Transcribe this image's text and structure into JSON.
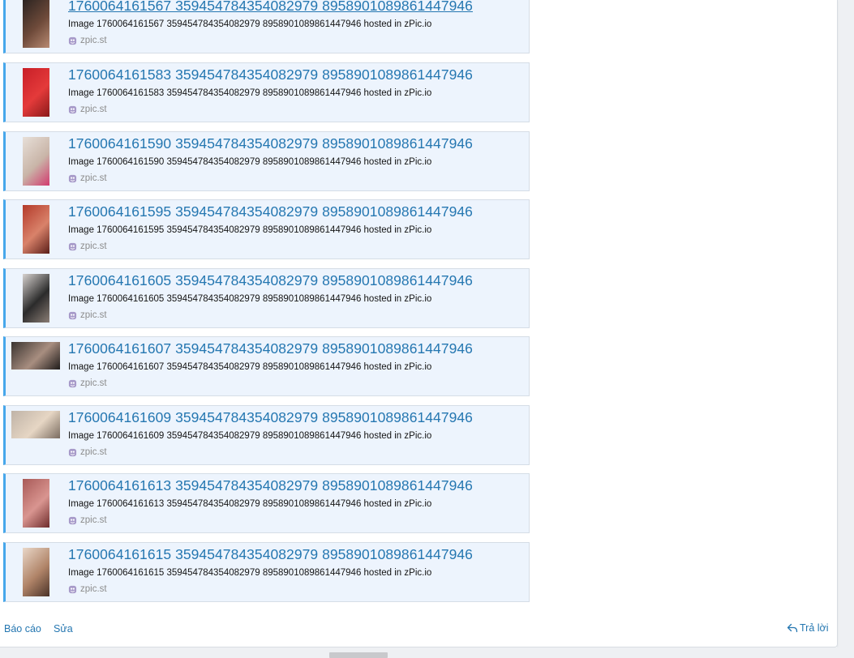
{
  "embeds": [
    {
      "title": "1760064161567 359454784354082979 8958901089861447946",
      "description": "Image 1760064161567 359454784354082979 8958901089861447946 hosted in zPic.io",
      "source": "zpic.st",
      "thumb_colors": [
        "#2a2320",
        "#6e4a3a",
        "#b88a72"
      ],
      "orientation": "portrait",
      "hovered": true
    },
    {
      "title": "1760064161583 359454784354082979 8958901089861447946",
      "description": "Image 1760064161583 359454784354082979 8958901089861447946 hosted in zPic.io",
      "source": "zpic.st",
      "thumb_colors": [
        "#c81f28",
        "#e43a3a",
        "#8a1a1a"
      ],
      "orientation": "portrait",
      "hovered": false
    },
    {
      "title": "1760064161590 359454784354082979 8958901089861447946",
      "description": "Image 1760064161590 359454784354082979 8958901089861447946 hosted in zPic.io",
      "source": "zpic.st",
      "thumb_colors": [
        "#e7dfd8",
        "#c9b5a8",
        "#d23a6e"
      ],
      "orientation": "portrait",
      "hovered": false
    },
    {
      "title": "1760064161595 359454784354082979 8958901089861447946",
      "description": "Image 1760064161595 359454784354082979 8958901089861447946 hosted in zPic.io",
      "source": "zpic.st",
      "thumb_colors": [
        "#b33a2a",
        "#d9826a",
        "#5a1e18"
      ],
      "orientation": "portrait",
      "hovered": false
    },
    {
      "title": "1760064161605 359454784354082979 8958901089861447946",
      "description": "Image 1760064161605 359454784354082979 8958901089861447946 hosted in zPic.io",
      "source": "zpic.st",
      "thumb_colors": [
        "#d7d2cf",
        "#2b2b2b",
        "#8a7d75"
      ],
      "orientation": "portrait",
      "hovered": false
    },
    {
      "title": "1760064161607 359454784354082979 8958901089861447946",
      "description": "Image 1760064161607 359454784354082979 8958901089861447946 hosted in zPic.io",
      "source": "zpic.st",
      "thumb_colors": [
        "#3a3430",
        "#a88e80",
        "#1e1b1a"
      ],
      "orientation": "landscape",
      "hovered": false
    },
    {
      "title": "1760064161609 359454784354082979 8958901089861447946",
      "description": "Image 1760064161609 359454784354082979 8958901089861447946 hosted in zPic.io",
      "source": "zpic.st",
      "thumb_colors": [
        "#bfb3a7",
        "#e6d6c4",
        "#7a6c60"
      ],
      "orientation": "landscape",
      "hovered": false
    },
    {
      "title": "1760064161613 359454784354082979 8958901089861447946",
      "description": "Image 1760064161613 359454784354082979 8958901089861447946 hosted in zPic.io",
      "source": "zpic.st",
      "thumb_colors": [
        "#a85a58",
        "#d99590",
        "#6e2c2c"
      ],
      "orientation": "portrait",
      "hovered": false
    },
    {
      "title": "1760064161615 359454784354082979 8958901089861447946",
      "description": "Image 1760064161615 359454784354082979 8958901089861447946 hosted in zPic.io",
      "source": "zpic.st",
      "thumb_colors": [
        "#e9d7c8",
        "#b08468",
        "#4a3228"
      ],
      "orientation": "portrait",
      "hovered": false
    }
  ],
  "footer": {
    "report_label": "Báo cáo",
    "edit_label": "Sửa",
    "reply_label": "Trả lời"
  },
  "colors": {
    "accent": "#47a7eb",
    "link": "#2577b1",
    "embed_bg": "#edf4fd"
  }
}
